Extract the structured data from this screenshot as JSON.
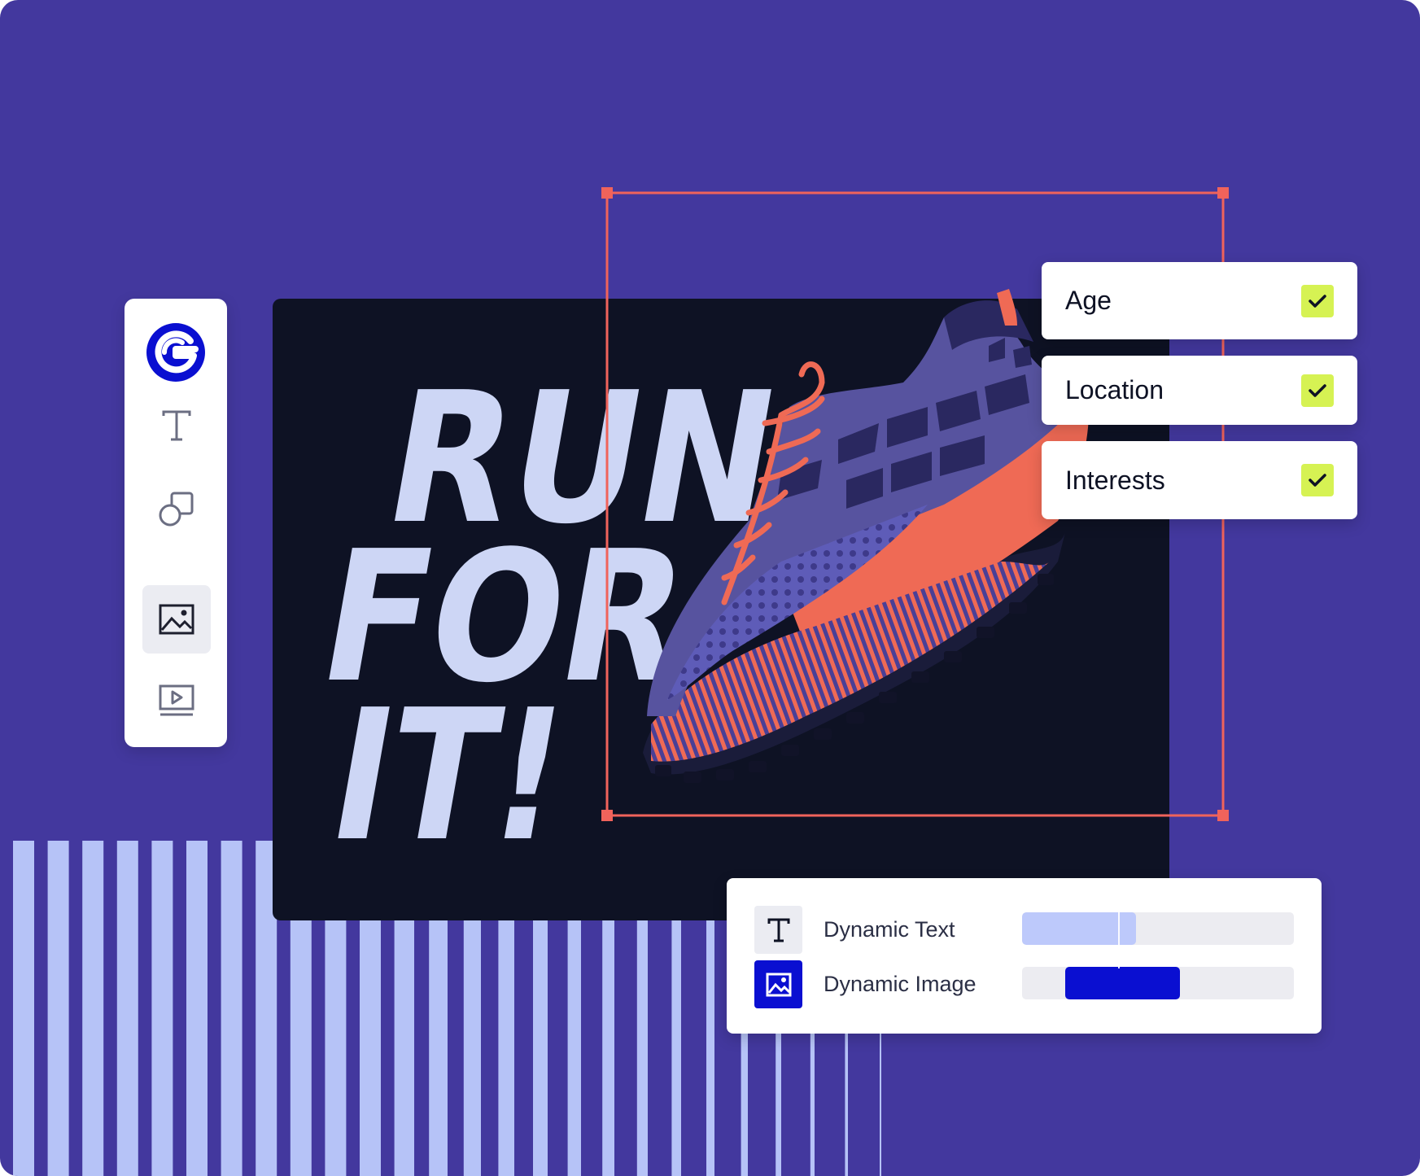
{
  "colors": {
    "background": "#43389e",
    "canvas": "#0e1224",
    "headline": "#cdd6f5",
    "selection": "#f0635b",
    "check": "#d6f253",
    "brand_blue": "#0a0fd1",
    "stripe": "#b6c3f7",
    "track": "#ececf1",
    "text_fill": "#bdc9fb",
    "image_fill": "#0a0fd1"
  },
  "toolbar": {
    "logo": "brand-logo",
    "tools": [
      {
        "name": "text-tool",
        "icon": "text-icon"
      },
      {
        "name": "shapes-tool",
        "icon": "shapes-icon"
      },
      {
        "name": "image-tool",
        "icon": "image-icon",
        "active": true
      },
      {
        "name": "video-tool",
        "icon": "video-icon"
      }
    ]
  },
  "headline": {
    "line1": "RUN",
    "line2": "FOR",
    "line3": "IT!"
  },
  "audience_filters": [
    {
      "label": "Age",
      "checked": true
    },
    {
      "label": "Location",
      "checked": true
    },
    {
      "label": "Interests",
      "checked": true
    }
  ],
  "dynamic": {
    "text_label": "Dynamic Text",
    "image_label": "Dynamic Image",
    "text_range": [
      0,
      0.42
    ],
    "image_range": [
      0.16,
      0.58
    ]
  }
}
